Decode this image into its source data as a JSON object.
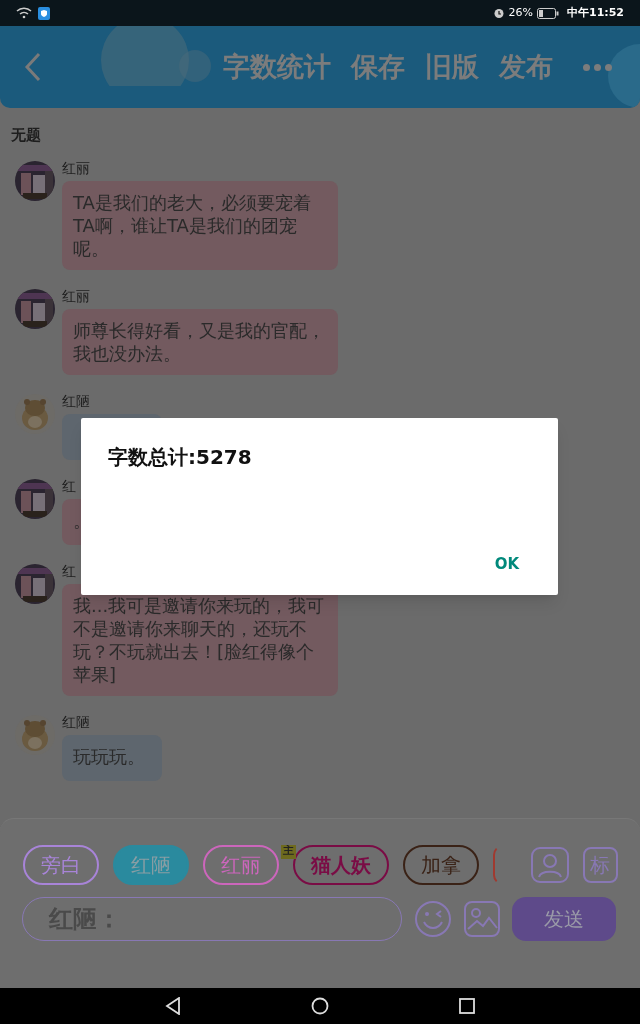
{
  "status_bar": {
    "battery": "26%",
    "time": "中午11:52"
  },
  "header": {
    "actions": [
      "字数统计",
      "保存",
      "旧版",
      "发布"
    ]
  },
  "title": "无题",
  "messages": [
    {
      "name": "红丽",
      "text": "TA是我们的老大，必须要宠着TA啊，谁让TA是我们的团宠呢。",
      "color": "#735a5f"
    },
    {
      "name": "红丽",
      "text": "师尊长得好看，又是我的官配，我也没办法。",
      "color": "#735a5f"
    },
    {
      "name": "红陋",
      "color": "#5e666e"
    },
    {
      "name": "红",
      "text": "。",
      "color": "#735a5f"
    },
    {
      "name": "红",
      "text": "我...我可是邀请你来玩的，我可不是邀请你来聊天的，还玩不玩？不玩就出去！[脸红得像个苹果]",
      "color": "#735a5f"
    },
    {
      "name": "红陋",
      "text": "玩玩玩。",
      "color": "#5e666e"
    }
  ],
  "roles": [
    {
      "label": "旁白",
      "selected": false,
      "color": "#a884d8"
    },
    {
      "label": "红陋",
      "selected": true,
      "color": "#2a8a9e"
    },
    {
      "label": "红丽",
      "selected": false,
      "color": "#cc66bc"
    },
    {
      "label": "猫人妖",
      "selected": false,
      "color": "#7a0c45",
      "badge": "主"
    },
    {
      "label": "加拿",
      "selected": false,
      "color": "#3a2216"
    },
    {
      "clipped": true,
      "color": "#a03a30"
    }
  ],
  "tag_button": "标",
  "input": {
    "label": "红陋："
  },
  "send_button": "发送",
  "dialog": {
    "message": "字数总计:5278",
    "button": "OK"
  }
}
